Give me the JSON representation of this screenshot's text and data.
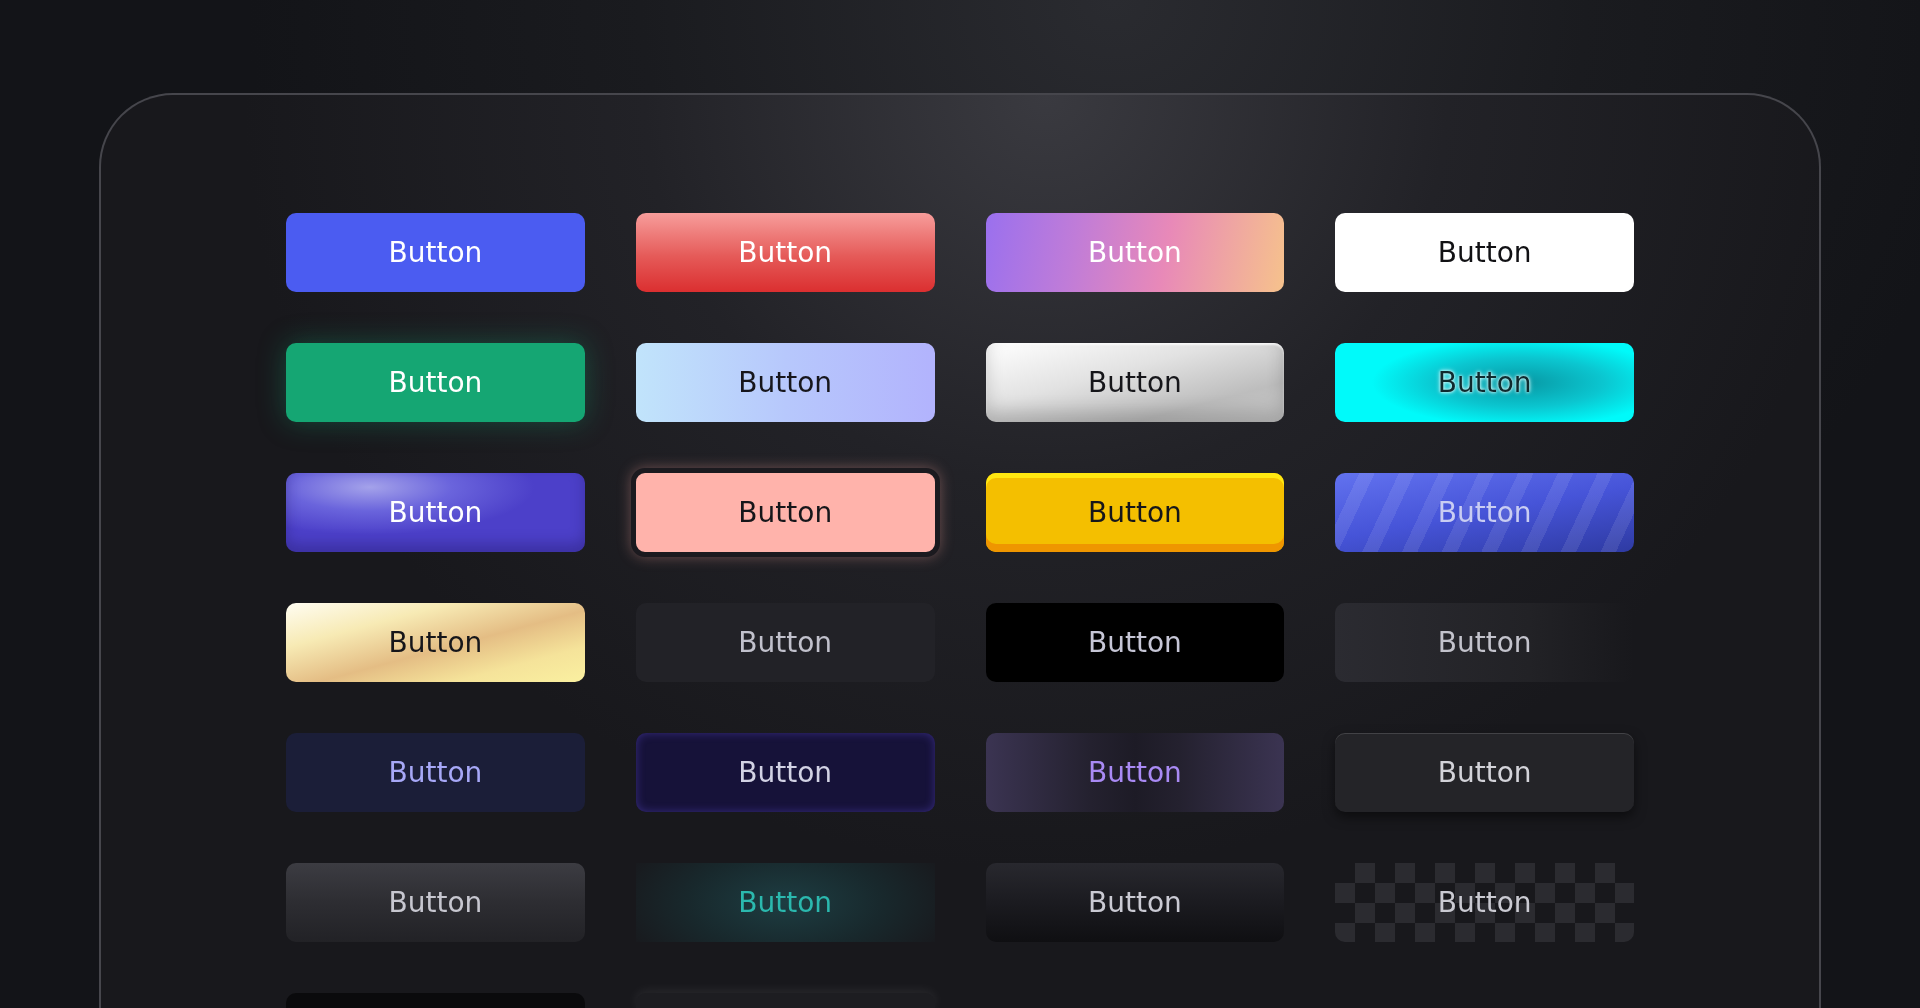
{
  "buttons": [
    {
      "label": "Button",
      "kind": "indigo"
    },
    {
      "label": "Button",
      "kind": "crimson"
    },
    {
      "label": "Button",
      "kind": "aurora"
    },
    {
      "label": "Button",
      "kind": "white"
    },
    {
      "label": "Button",
      "kind": "emerald"
    },
    {
      "label": "Button",
      "kind": "sky"
    },
    {
      "label": "Button",
      "kind": "silver"
    },
    {
      "label": "Button",
      "kind": "cyan"
    },
    {
      "label": "Button",
      "kind": "glass"
    },
    {
      "label": "Button",
      "kind": "salmon"
    },
    {
      "label": "Button",
      "kind": "yellow"
    },
    {
      "label": "Button",
      "kind": "stripes"
    },
    {
      "label": "Button",
      "kind": "champagne"
    },
    {
      "label": "Button",
      "kind": "charcoal"
    },
    {
      "label": "Button",
      "kind": "black"
    },
    {
      "label": "Button",
      "kind": "fade"
    },
    {
      "label": "Button",
      "kind": "navy"
    },
    {
      "label": "Button",
      "kind": "midnight"
    },
    {
      "label": "Button",
      "kind": "dusk"
    },
    {
      "label": "Button",
      "kind": "raised"
    },
    {
      "label": "Button",
      "kind": "graphite"
    },
    {
      "label": "Button",
      "kind": "teal"
    },
    {
      "label": "Button",
      "kind": "obsidian"
    },
    {
      "label": "Button",
      "kind": "checker"
    },
    {
      "kind": "ink"
    },
    {
      "kind": "smoke"
    }
  ]
}
